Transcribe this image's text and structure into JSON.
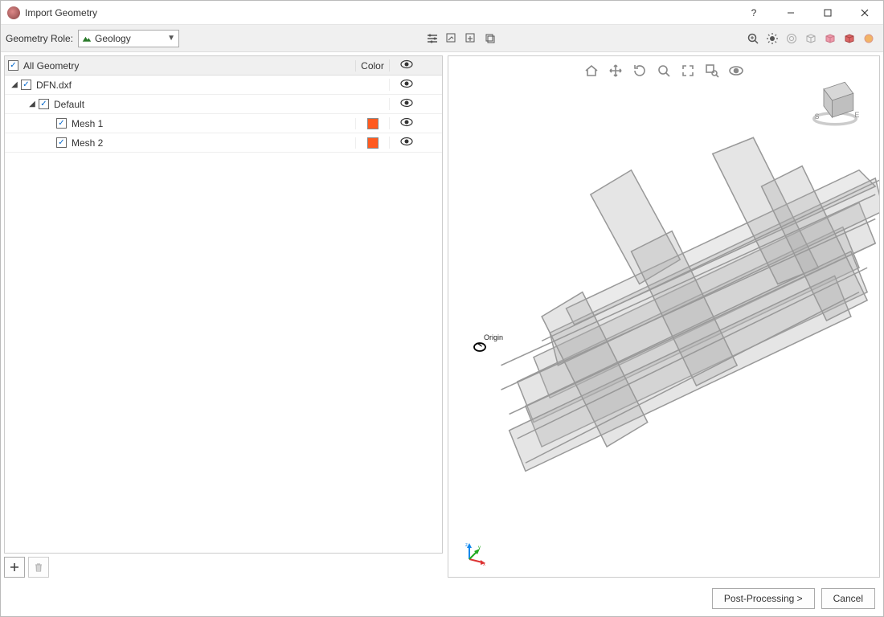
{
  "window": {
    "title": "Import Geometry"
  },
  "toolbar": {
    "role_label": "Geometry Role:",
    "role_value": "Geology"
  },
  "tree": {
    "header": {
      "name": "All Geometry",
      "color": "Color"
    },
    "rows": [
      {
        "indent": 0,
        "label": "DFN.dxf",
        "expanded": true,
        "color": null
      },
      {
        "indent": 1,
        "label": "Default",
        "expanded": true,
        "color": null
      },
      {
        "indent": 2,
        "label": "Mesh 1",
        "expanded": null,
        "color": "#ff5a1f"
      },
      {
        "indent": 2,
        "label": "Mesh 2",
        "expanded": null,
        "color": "#ff5a1f"
      }
    ]
  },
  "viewport": {
    "origin_label": "Origin",
    "navcube": {
      "compass_s": "S",
      "compass_e": "E"
    }
  },
  "footer": {
    "next": "Post-Processing >",
    "cancel": "Cancel"
  }
}
